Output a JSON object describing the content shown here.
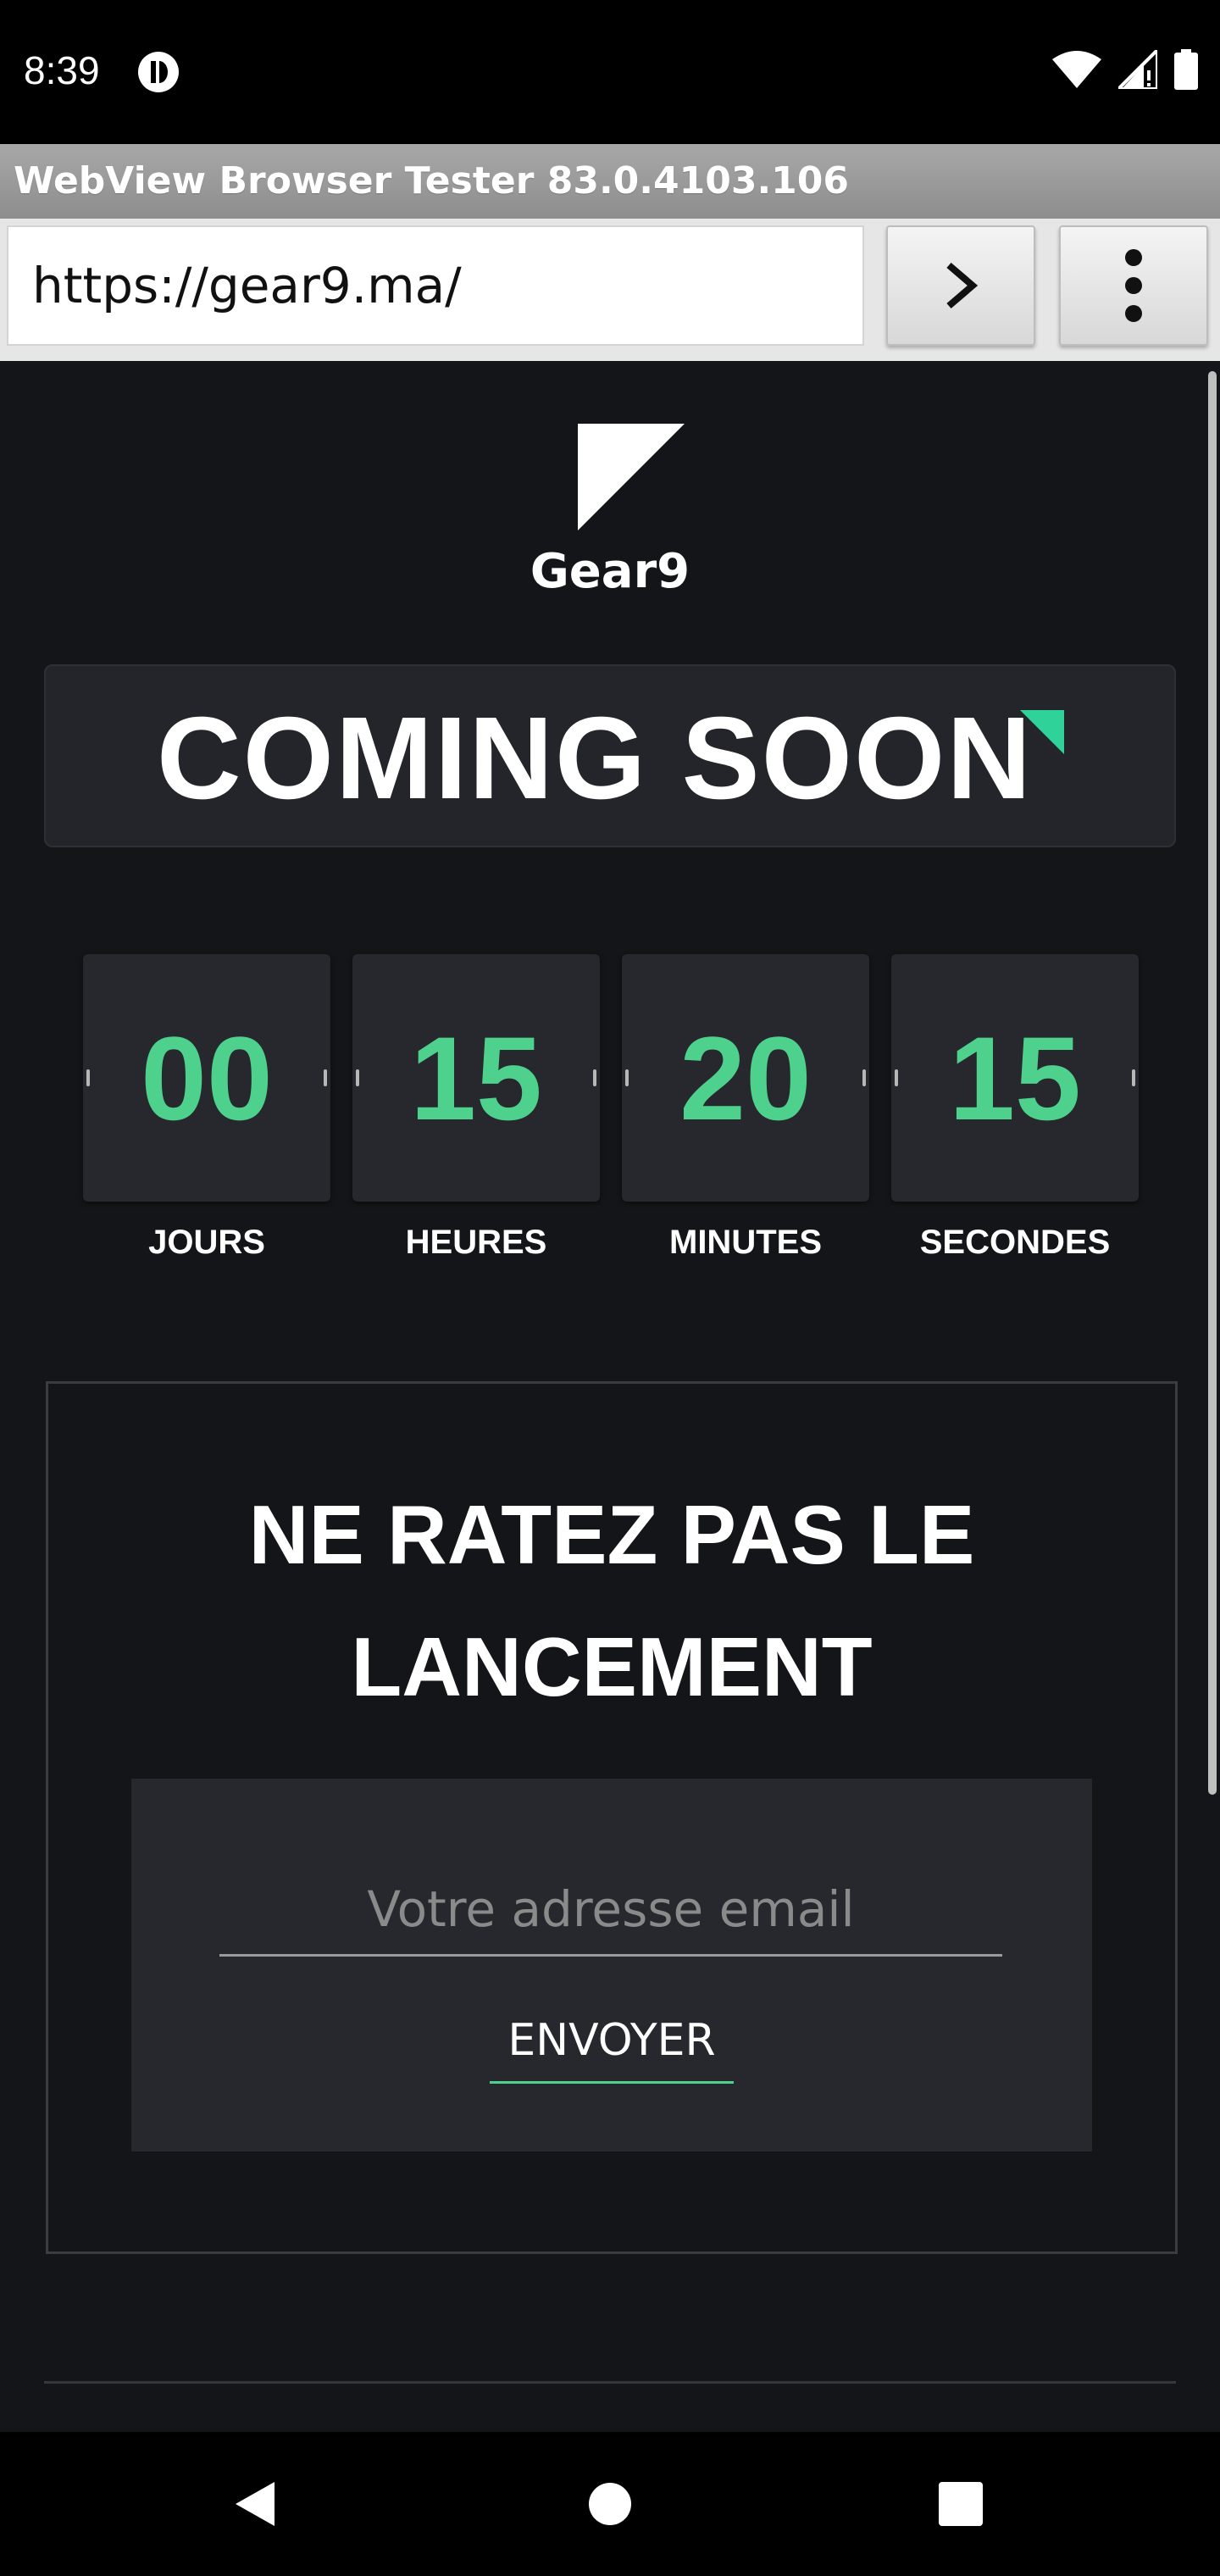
{
  "status_bar": {
    "time": "8:39"
  },
  "browser": {
    "title": "WebView Browser Tester 83.0.4103.106",
    "url": "https://gear9.ma/"
  },
  "page": {
    "brand": "Gear9",
    "headline": "COMING SOON",
    "accent_color": "#4fd18e",
    "countdown": [
      {
        "value": "00",
        "label": "JOURS"
      },
      {
        "value": "15",
        "label": "HEURES"
      },
      {
        "value": "20",
        "label": "MINUTES"
      },
      {
        "value": "15",
        "label": "SECONDES"
      }
    ],
    "newsletter": {
      "title_line1": "NE RATEZ PAS LE",
      "title_line2": "LANCEMENT",
      "email_placeholder": "Votre adresse email",
      "submit_label": "ENVOYER"
    }
  }
}
